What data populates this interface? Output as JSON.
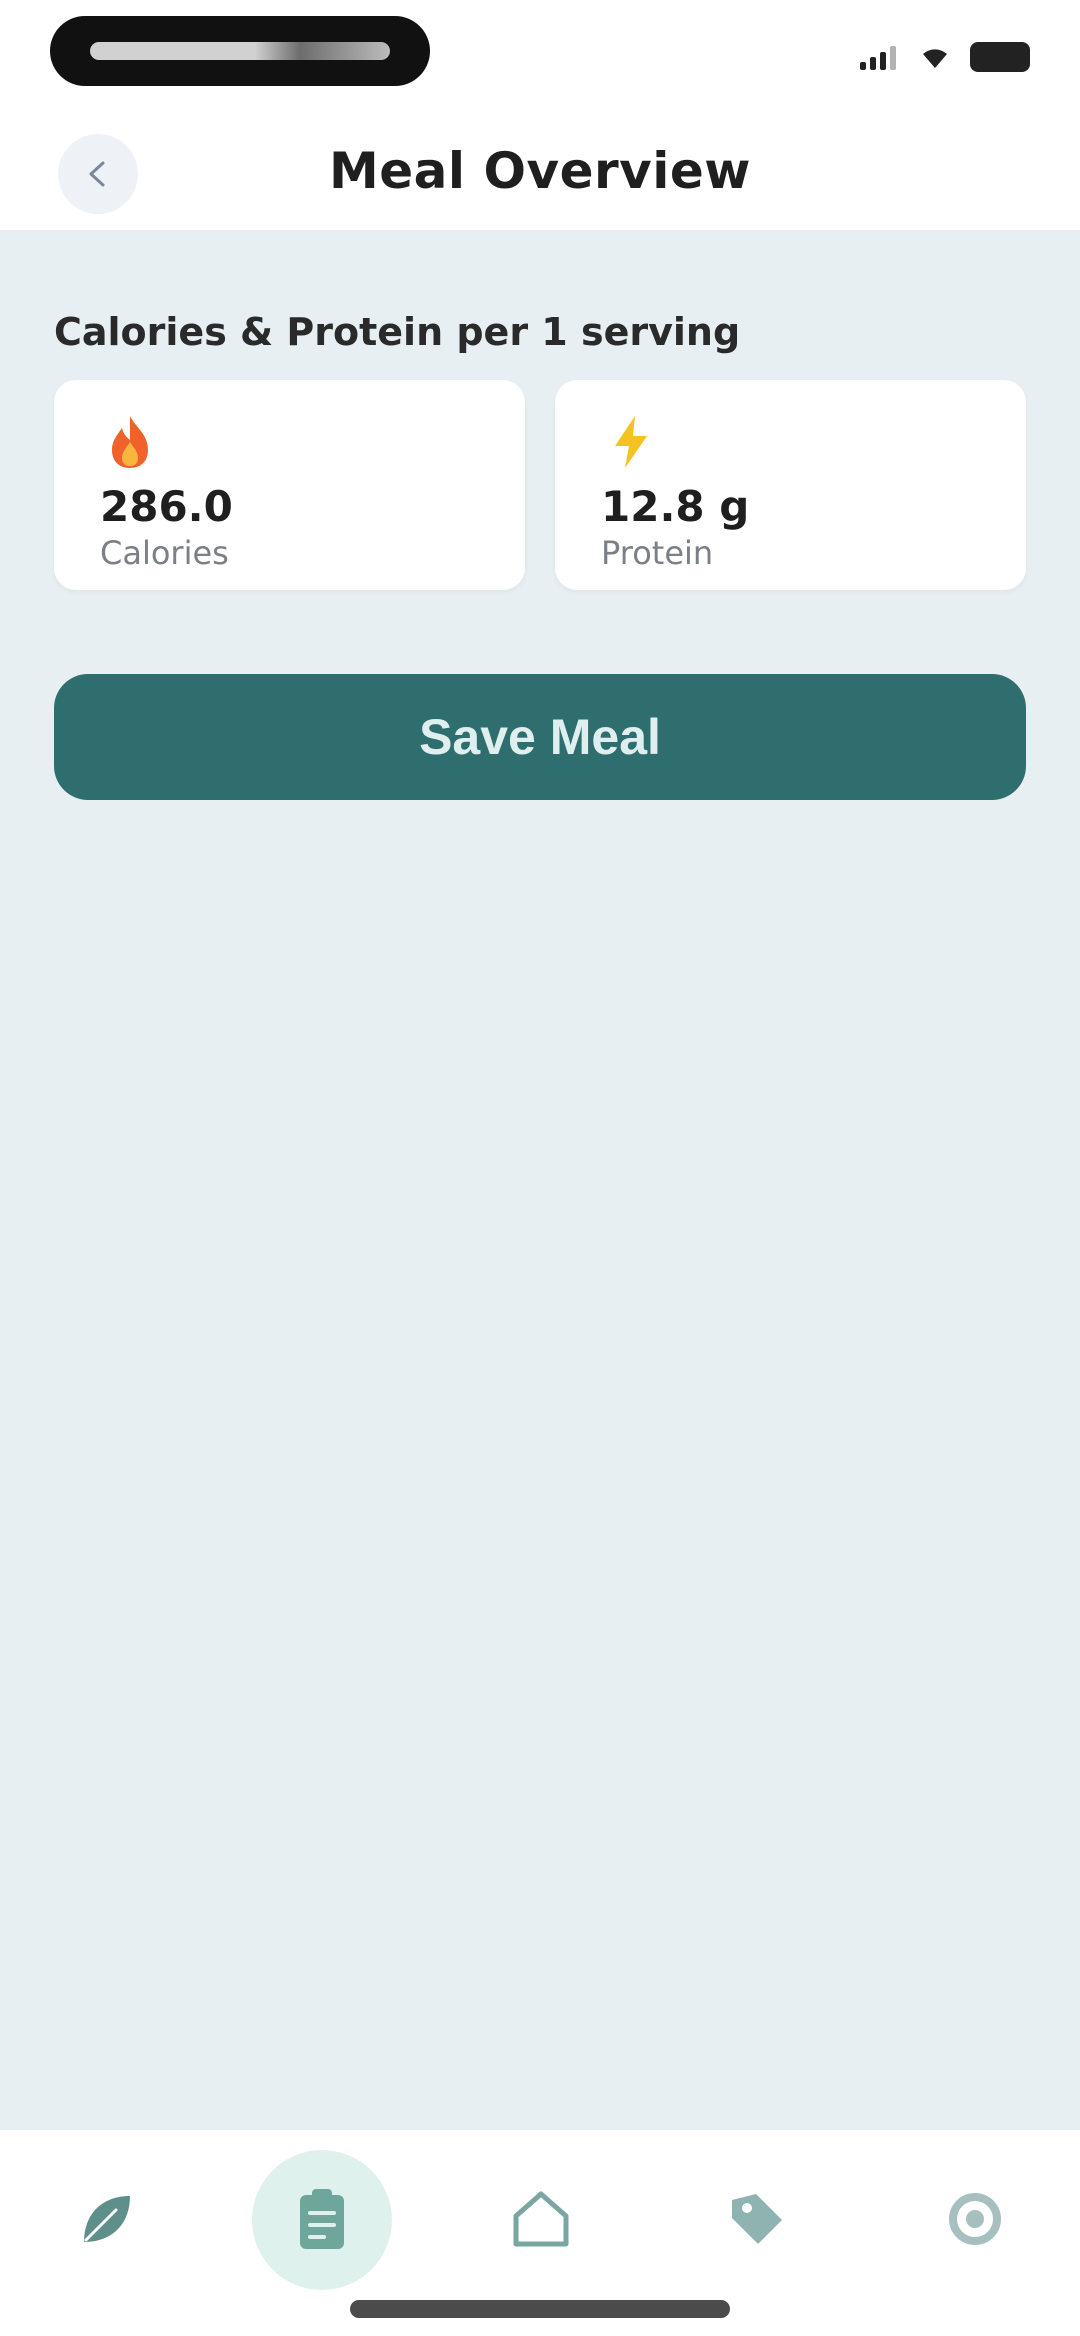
{
  "header": {
    "title": "Meal Overview",
    "back_icon": "arrow-left-icon"
  },
  "main": {
    "section_label": "Calories & Protein per 1 serving",
    "cards": [
      {
        "icon": "flame-icon",
        "value": "286.0",
        "label": "Calories"
      },
      {
        "icon": "lightning-bolt-icon",
        "value": "12.8 g",
        "label": "Protein"
      }
    ],
    "save_button_label": "Save Meal"
  },
  "bottom_nav": {
    "items": [
      {
        "icon": "leaf-icon"
      },
      {
        "icon": "clipboard-icon",
        "active": true
      },
      {
        "icon": "home-icon"
      },
      {
        "icon": "tag-icon"
      },
      {
        "icon": "gear-icon"
      }
    ]
  },
  "colors": {
    "accent": "#2f6e6e",
    "background": "#e8eff2",
    "nav_active_bg": "#dff1ec",
    "flame": "#f0622a",
    "bolt": "#f5c224"
  }
}
